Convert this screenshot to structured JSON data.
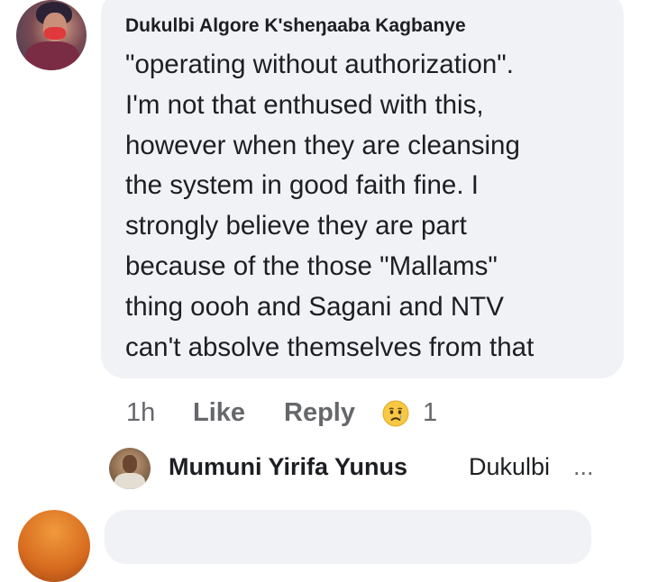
{
  "comment": {
    "author": "Dukulbi Algore K'sheŋaaba Kagbanye",
    "lines": [
      "\"operating without authorization\".",
      "I'm not that enthused with this,",
      "however when they are cleansing",
      "the system in good faith fine. I",
      "strongly believe they are part",
      "because of the those \"Mallams\"",
      "thing oooh and Sagani and NTV",
      "can't absolve themselves from that"
    ]
  },
  "actions": {
    "time": "1h",
    "like": "Like",
    "reply": "Reply",
    "reaction_icon": "sad-face-emoji",
    "reaction_count": "1"
  },
  "reply_preview": {
    "author": "Mumuni Yirifa Yunus",
    "text": "Dukulbi",
    "ellipsis": "..."
  },
  "colors": {
    "bubble": "#f0f2f5",
    "text": "#1c1e21",
    "secondary_text": "#65676b"
  }
}
